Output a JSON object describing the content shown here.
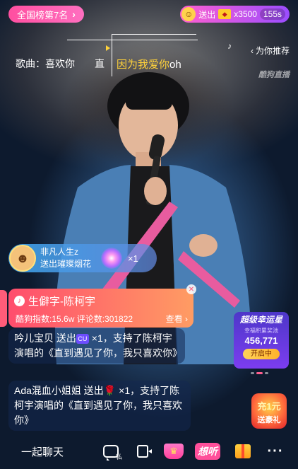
{
  "top_bar": {
    "rank_label": "全国榜第7名",
    "rank_chevron": "›",
    "gift_label": "送出",
    "gift_count": "x3500",
    "gift_timer": "155s"
  },
  "lyrics": {
    "song_label": "歌曲：",
    "song_name": "喜欢你",
    "prev_lyric": "直",
    "current_lyric_highlight": "因为我爱你",
    "current_lyric_rest": "oh"
  },
  "recommend": {
    "label": "为你推荐"
  },
  "watermark": {
    "text": "酷狗直播"
  },
  "gift_notice": {
    "user": "非凡人生z",
    "action": "送出璀璨烟花",
    "count": "×1"
  },
  "song_card": {
    "title": "生僻字-陈柯宇",
    "stats": "酷狗指数:15.6w  评论数:301822",
    "view_label": "查看 ›"
  },
  "chat_messages": [
    {
      "prefix": "吟儿宝贝 送出",
      "badge": "CU",
      "suffix": " ×1，支持了陈柯宇演唱的《直到遇见了你，我只喜欢你》"
    },
    {
      "prefix": "Ada混血小姐姐 送出",
      "badge": "🌹",
      "suffix": " ×1，支持了陈柯宇演唱的《直到遇见了你，我只喜欢你》"
    }
  ],
  "lucky_panel": {
    "title": "超级幸运星",
    "subtitle": "幸福积累奖池",
    "value": "456,771",
    "button": "开启中"
  },
  "recharge_promo": {
    "top": "充1元",
    "bottom": "送豪礼"
  },
  "toolbar": {
    "chat_placeholder": "一起聊天",
    "private_label": "私",
    "listen_logo": "想听",
    "more": "···"
  },
  "icons": {
    "rank": "chevron-right-icon",
    "recommend": "chevron-left-icon",
    "private_chat": "chat-bubble-icon",
    "video": "camera-icon",
    "crown": "crown-icon",
    "gift": "gift-icon",
    "more": "more-icon"
  },
  "colors": {
    "rank_pill": "#ff4fa0",
    "lyric_highlight": "#ffd23a",
    "song_card_start": "#ff4d6d",
    "song_card_end": "#ff9c63",
    "lucky_panel": "#4d37c9"
  }
}
